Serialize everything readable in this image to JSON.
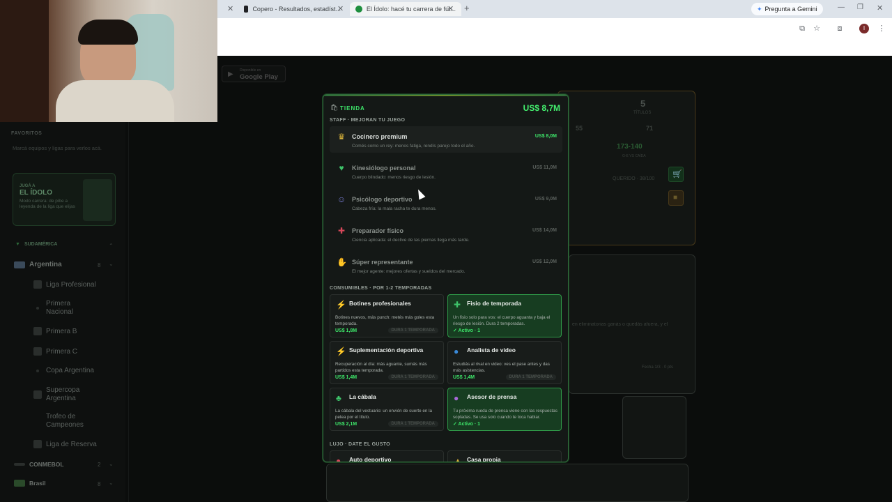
{
  "browser": {
    "tabs": [
      {
        "label": "Copero - Resultados, estadíst...",
        "active": false
      },
      {
        "label": "El Ídolo: hacé tu carrera de fút...",
        "active": true
      }
    ],
    "new_tab": "+",
    "gemini_label": "Pregunta a Gemini",
    "profile_initial": "I"
  },
  "store_badge": {
    "small": "Disponible en",
    "big": "Google Play"
  },
  "sidebar": {
    "favorites_head": "FAVORITOS",
    "favorites_hint": "Marcá equipos y ligas para verlos acá.",
    "promo": {
      "small": "JUGÁ A",
      "title": "EL ÍDOLO",
      "desc": "Modo carrera: de pibe a leyenda de la liga que elijas"
    },
    "region": "SUDAMÉRICA",
    "country": "Argentina",
    "country_count": "8",
    "leagues": [
      "Liga Profesional",
      "Primera Nacional",
      "Primera B",
      "Primera C",
      "Copa Argentina",
      "Supercopa Argentina",
      "Trofeo de Campeones",
      "Liga de Reserva"
    ],
    "conmebol": "CONMEBOL",
    "conmebol_count": "2",
    "brasil": "Brasil",
    "brasil_count": "8"
  },
  "background": {
    "titles_count": "5",
    "titles_label": "TÍTULOS",
    "stat1": "55",
    "stat2": "71",
    "record": "173-140",
    "record_label": "G-E VS CAÍDA",
    "mood": "QUERIDO · 38/100",
    "elim_text": "en eliminatorias ganás o quedás afuera, y el",
    "fecha": "Fecha 1/3 · 0 pts"
  },
  "shop": {
    "title": "TIENDA",
    "budget": "US$ 8,7M",
    "staff_head": "STAFF · MEJORAN TU JUEGO",
    "staff": [
      {
        "icon": "chef-icon",
        "glyph": "♛",
        "color": "#d8b23a",
        "name": "Cocinero premium",
        "desc": "Comés como un rey: menos fatiga, rendís parejo todo el año.",
        "price": "US$ 8,0M",
        "affordable": true
      },
      {
        "icon": "heart-icon",
        "glyph": "♥",
        "color": "#3ec46a",
        "name": "Kinesiólogo personal",
        "desc": "Cuerpo blindado: menos riesgo de lesión.",
        "price": "US$ 11,0M",
        "affordable": false
      },
      {
        "icon": "person-icon",
        "glyph": "☺",
        "color": "#7a7fd8",
        "name": "Psicólogo deportivo",
        "desc": "Cabeza fría: la mala racha te dura menos.",
        "price": "US$ 9,0M",
        "affordable": false
      },
      {
        "icon": "dumbbell-icon",
        "glyph": "✚",
        "color": "#d8485a",
        "name": "Preparador físico",
        "desc": "Ciencia aplicada: el declive de las piernas llega más tarde.",
        "price": "US$ 14,0M",
        "affordable": false
      },
      {
        "icon": "handshake-icon",
        "glyph": "✋",
        "color": "#6a8ad8",
        "name": "Súper representante",
        "desc": "El mejor agente: mejores ofertas y sueldos del mercado.",
        "price": "US$ 12,0M",
        "affordable": false
      }
    ],
    "consumables_head": "CONSUMIBLES · POR 1-2 TEMPORADAS",
    "consumables": [
      {
        "icon": "boot-icon",
        "glyph": "⚡",
        "color": "#d8485a",
        "name": "Botines profesionales",
        "desc": "Botines nuevos, más punch: metés más goles esta temporada.",
        "price": "US$ 1,8M",
        "duration": "DURA 1 TEMPORADA",
        "active": false,
        "status": ""
      },
      {
        "icon": "bandage-icon",
        "glyph": "✚",
        "color": "#3ec46a",
        "name": "Fisio de temporada",
        "desc": "Un fisio solo para vos: el cuerpo aguanta y baja el riesgo de lesión. Dura 2 temporadas.",
        "price": "",
        "duration": "",
        "active": true,
        "status": "✓ Activo · 1"
      },
      {
        "icon": "lightning-icon",
        "glyph": "⚡",
        "color": "#e8c23a",
        "name": "Suplementación deportiva",
        "desc": "Recuperación al día: más aguante, sumás más partidos esta temporada.",
        "price": "US$ 1,4M",
        "duration": "DURA 1 TEMPORADA",
        "active": false,
        "status": ""
      },
      {
        "icon": "globe-icon",
        "glyph": "●",
        "color": "#3a8ad8",
        "name": "Analista de video",
        "desc": "Estudiás al rival en video: ves el pase antes y das más asistencias.",
        "price": "US$ 1,4M",
        "duration": "DURA 1 TEMPORADA",
        "active": false,
        "status": ""
      },
      {
        "icon": "clover-icon",
        "glyph": "♣",
        "color": "#3ec46a",
        "name": "La cábala",
        "desc": "La cábala del vestuario: un envión de suerte en la pelea por el título.",
        "price": "US$ 2,1M",
        "duration": "DURA 1 TEMPORADA",
        "active": false,
        "status": ""
      },
      {
        "icon": "microphone-icon",
        "glyph": "●",
        "color": "#a86ad8",
        "name": "Asesor de prensa",
        "desc": "Tu próxima rueda de prensa viene con las respuestas sopladas. Se usa solo cuando te toca hablar.",
        "price": "",
        "duration": "",
        "active": true,
        "status": "✓ Activo · 1"
      }
    ],
    "luxury_head": "LUJO · DATE EL GUSTO",
    "luxury": [
      {
        "icon": "car-icon",
        "glyph": "●",
        "color": "#d8485a",
        "name": "Auto deportivo"
      },
      {
        "icon": "house-icon",
        "glyph": "▲",
        "color": "#d8b23a",
        "name": "Casa propia"
      }
    ]
  }
}
